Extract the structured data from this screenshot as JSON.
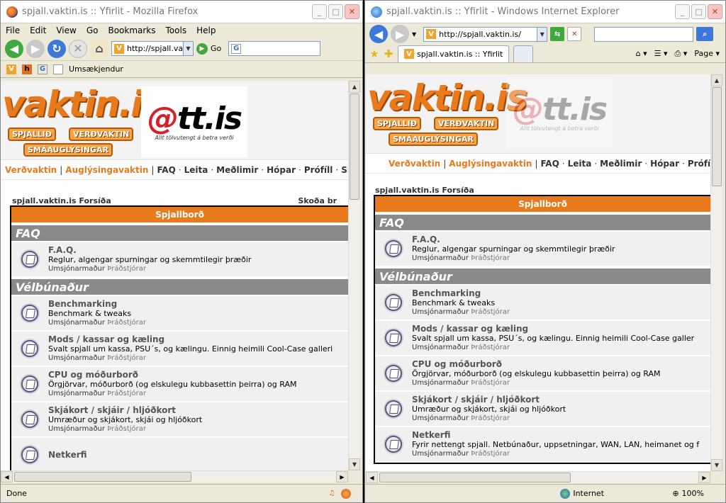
{
  "firefox": {
    "title": "spjall.vaktin.is :: Yfirlit - Mozilla Firefox",
    "menu": [
      "File",
      "Edit",
      "View",
      "Go",
      "Bookmarks",
      "Tools",
      "Help"
    ],
    "address": "http://spjall.va",
    "go_label": "Go",
    "bookmark": "Umsækjendur",
    "status": "Done",
    "nav": [
      "Verðvaktin",
      "Auglýsingavaktin",
      "FAQ",
      "Leita",
      "Meðlimir",
      "Hópar",
      "Prófíll",
      "Ski"
    ],
    "breadcrumb": "spjall.vaktin.is Forsíða",
    "breadcrumb_right": "Skoða br",
    "forum_header": "Spjallborð",
    "sections": [
      {
        "category": "FAQ",
        "rows": [
          {
            "title": "F.A.Q.",
            "desc": "Reglur, algengar spurningar og skemmtilegir þræðir",
            "mod_label": "Umsjónarmaður",
            "mod": "Þráðstjórar"
          }
        ]
      },
      {
        "category": "Vélbúnaður",
        "rows": [
          {
            "title": "Benchmarking",
            "desc": "Benchmark & tweaks",
            "mod_label": "Umsjónarmaður",
            "mod": "Þráðstjórar"
          },
          {
            "title": "Mods / kassar og kæling",
            "desc": "Svalt spjall um kassa, PSU´s, og kælingu. Einnig heimili Cool-Case galleri",
            "mod_label": "Umsjónarmaður",
            "mod": "Þráðstjórar"
          },
          {
            "title": "CPU og móðurborð",
            "desc": "Örgjörvar, móðurborð (og elskulegu kubbasettin þeirra) og RAM",
            "mod_label": "Umsjónarmaður",
            "mod": "Þráðstjórar"
          },
          {
            "title": "Skjákort / skjáir / hljóðkort",
            "desc": "Umræður og skjákort, skjái og hljóðkort",
            "mod_label": "Umsjónarmaður",
            "mod": "Þráðstjórar"
          },
          {
            "title": "Netkerfi",
            "desc": "",
            "mod_label": "",
            "mod": ""
          }
        ]
      }
    ]
  },
  "ie": {
    "title": "spjall.vaktin.is :: Yfirlit - Windows Internet Explorer",
    "address": "http://spjall.vaktin.is/",
    "tab": "spjall.vaktin.is :: Yfirlit",
    "page_menu": "Page",
    "zone": "Internet",
    "zoom": "100%",
    "nav": [
      "Verðvaktin",
      "Auglýsingavaktin",
      "FAQ",
      "Leita",
      "Meðlimir",
      "Hópar",
      "Prófíll"
    ],
    "breadcrumb": "spjall.vaktin.is Forsíða",
    "forum_header": "Spjallborð",
    "sections": [
      {
        "category": "FAQ",
        "rows": [
          {
            "title": "F.A.Q.",
            "desc": "Reglur, algengar spurningar og skemmtilegir þræðir",
            "mod_label": "Umsjónarmaður",
            "mod": "Þráðstjórar"
          }
        ]
      },
      {
        "category": "Vélbúnaður",
        "rows": [
          {
            "title": "Benchmarking",
            "desc": "Benchmark & tweaks",
            "mod_label": "Umsjónarmaður",
            "mod": "Þráðstjórar"
          },
          {
            "title": "Mods / kassar og kæling",
            "desc": "Svalt spjall um kassa, PSU´s, og kælingu. Einnig heimili Cool-Case galler",
            "mod_label": "Umsjónarmaður",
            "mod": "Þráðstjórar"
          },
          {
            "title": "CPU og móðurborð",
            "desc": "Örgjörvar, móðurborð (og elskulegu kubbasettin þeirra) og RAM",
            "mod_label": "Umsjónarmaður",
            "mod": "Þráðstjórar"
          },
          {
            "title": "Skjákort / skjáir / hljóðkort",
            "desc": "Umræður og skjákort, skjái og hljóðkort",
            "mod_label": "Umsjónarmaður",
            "mod": "Þráðstjórar"
          },
          {
            "title": "Netkerfi",
            "desc": "Fyrir nettengt spjall. Netbúnaður, uppsetningar, WAN, LAN, heimanet og f",
            "mod_label": "Umsjónarmaður",
            "mod": "Þráðstjórar"
          }
        ]
      }
    ]
  },
  "site": {
    "logo": "vaktin.is",
    "tags": [
      "SPJALLIÐ",
      "VERÐVAKTIN",
      "SMÁAUGLÝSINGAR"
    ],
    "ad_logo_at": "@",
    "ad_logo_rest": "tt.is",
    "ad_tagline": "Allt tölvutengt á betra verði"
  }
}
